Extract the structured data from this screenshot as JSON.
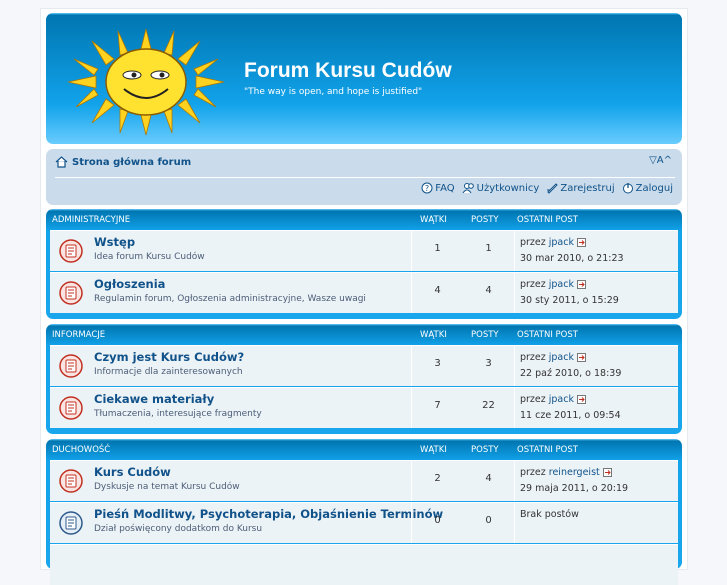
{
  "site": {
    "title": "Forum Kursu Cudów",
    "description": "\"The way is open, and hope is justified\""
  },
  "nav": {
    "breadcrumb": "Strona główna forum",
    "font_size_control": "▽A^",
    "links": [
      {
        "label": "FAQ",
        "icon": "faq-icon"
      },
      {
        "label": "Użytkownicy",
        "icon": "members-icon"
      },
      {
        "label": "Zarejestruj",
        "icon": "register-icon"
      },
      {
        "label": "Zaloguj",
        "icon": "login-icon"
      }
    ]
  },
  "columns": {
    "topics": "WĄTKI",
    "posts": "POSTY",
    "last_post": "OSTATNI POST"
  },
  "categories": [
    {
      "name": "ADMINISTRACYJNE",
      "forums": [
        {
          "name": "Wstęp",
          "desc": "Idea forum Kursu Cudów",
          "topics": "1",
          "posts": "1",
          "by_prefix": "przez",
          "author": "jpack",
          "date": "30 mar 2010, o 21:23",
          "unread": true
        },
        {
          "name": "Ogłoszenia",
          "desc": "Regulamin forum, Ogłoszenia administracyjne, Wasze uwagi",
          "topics": "4",
          "posts": "4",
          "by_prefix": "przez",
          "author": "jpack",
          "date": "30 sty 2011, o 15:29",
          "unread": true
        }
      ]
    },
    {
      "name": "INFORMACJE",
      "forums": [
        {
          "name": "Czym jest Kurs Cudów?",
          "desc": "Informacje dla zainteresowanych",
          "topics": "3",
          "posts": "3",
          "by_prefix": "przez",
          "author": "jpack",
          "date": "22 paź 2010, o 18:39",
          "unread": true
        },
        {
          "name": "Ciekawe materiały",
          "desc": "Tłumaczenia, interesujące fragmenty",
          "topics": "7",
          "posts": "22",
          "by_prefix": "przez",
          "author": "jpack",
          "date": "11 cze 2011, o 09:54",
          "unread": true
        }
      ]
    },
    {
      "name": "DUCHOWOŚĆ",
      "forums": [
        {
          "name": "Kurs Cudów",
          "desc": "Dyskusje na temat Kursu Cudów",
          "topics": "2",
          "posts": "4",
          "by_prefix": "przez",
          "author": "reinergeist",
          "date": "29 maja 2011, o 20:19",
          "unread": true
        },
        {
          "name": "Pieśń Modlitwy, Psychoterapia, Objaśnienie Terminów",
          "desc": "Dział poświęcony dodatkom do Kursu",
          "topics": "0",
          "posts": "0",
          "no_posts": "Brak postów",
          "unread": false
        }
      ]
    }
  ],
  "colors": {
    "header_blue": "#12a3eb",
    "row_bg": "#ecf3f7",
    "link": "#105289",
    "unread_icon": "#c03020",
    "read_icon": "#2d5a8c"
  }
}
